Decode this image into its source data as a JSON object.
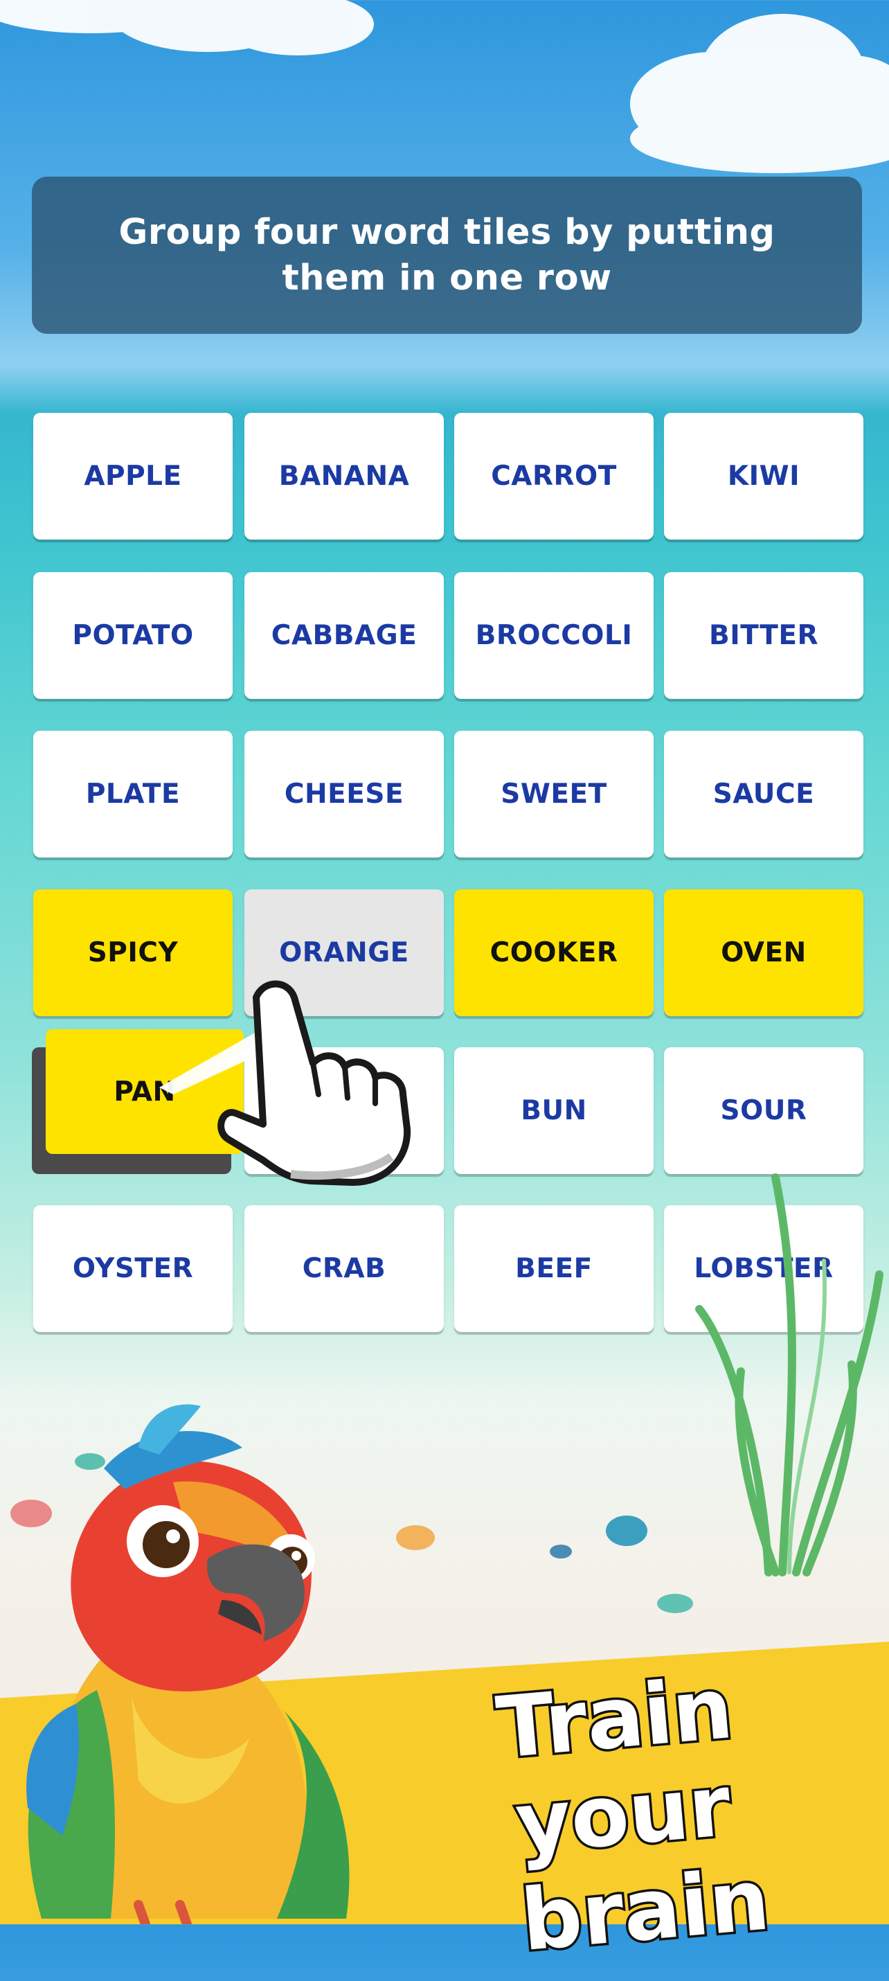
{
  "instruction": "Group four word tiles by putting them in one row",
  "board": {
    "rows": [
      [
        "APPLE",
        "BANANA",
        "CARROT",
        "KIWI"
      ],
      [
        "POTATO",
        "CABBAGE",
        "BROCCOLI",
        "BITTER"
      ],
      [
        "PLATE",
        "CHEESE",
        "SWEET",
        "SAUCE"
      ],
      [
        "SPICY",
        "ORANGE",
        "COOKER",
        "OVEN"
      ],
      [
        "",
        "",
        "BUN",
        "SOUR"
      ],
      [
        "OYSTER",
        "CRAB",
        "BEEF",
        "LOBSTER"
      ]
    ],
    "dragged_tile": "PAN"
  },
  "promo": {
    "line1": "Train your",
    "line2": "brain"
  },
  "colors": {
    "tile_bg": "#ffffff",
    "tile_text": "#1b3aa3",
    "selected_bg": "#ffe300",
    "banner_bg": "#2a5270",
    "promo_band": "#f8cc2b"
  }
}
